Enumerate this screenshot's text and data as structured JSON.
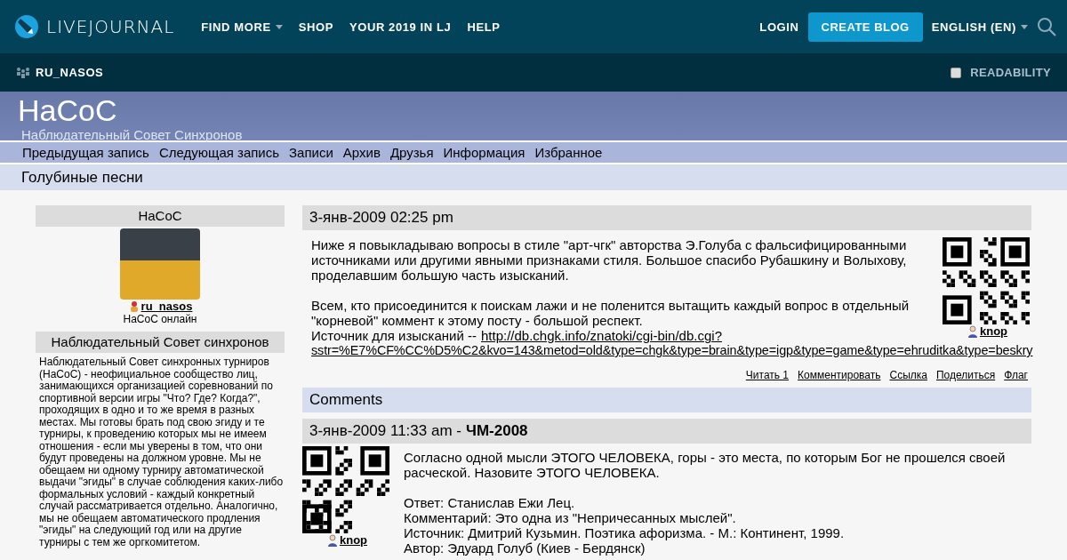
{
  "topbar": {
    "logo": "LIVEJOURNAL",
    "nav": [
      {
        "label": "FIND MORE",
        "dropdown": true
      },
      {
        "label": "SHOP",
        "dropdown": false
      },
      {
        "label": "YOUR 2019 IN LJ",
        "dropdown": false
      },
      {
        "label": "HELP",
        "dropdown": false
      }
    ],
    "login": "LOGIN",
    "create": "CREATE BLOG",
    "language": "ENGLISH (EN)"
  },
  "journalbar": {
    "name": "RU_NASOS",
    "readability": {
      "label": "READABILITY",
      "checked": false
    }
  },
  "blog": {
    "title": "НаСоС",
    "subtitle": "Наблюдательный Совет Синхронов"
  },
  "blognav": [
    "Предыдущая запись",
    "Следующая запись",
    "Записи",
    "Архив",
    "Друзья",
    "Информация",
    "Избранное"
  ],
  "page_title": "Голубиные песни",
  "sidebar": {
    "profile_title": "НаСоС",
    "username": "ru_nasos",
    "status": "НаСоС онлайн",
    "about_title": "Наблюдательный Совет синхронов",
    "about": "Наблюдательный Совет синхронных турниров (НаСоС) - неофициальное сообщество лиц, занимающихся организацией соревнований по спортивной версии игры \"Что? Где? Когда?\", проходящих в одно и то же время в разных местах. Мы готовы брать под свою эгиду и те турниры, к проведению которых мы не имеем отношения - если мы уверены в том, что они будут проведены на должном уровне. Мы не обещаем ни одному турниру автоматической выдачи \"эгиды\" в случае соблюдения каких-либо формальных условий - каждый конкретный случай рассматривается отдельно. Аналогично, мы не обещаем автоматического продления \"эгиды\" на следующий год или на другие турниры с тем же оргкомитетом."
  },
  "entry": {
    "date": "3-янв-2009 02:25 pm",
    "author": "knop",
    "paragraphs": [
      "Ниже я повыкладываю вопросы в стиле \"арт-чгк\" авторства Э.Голуба с фальсифицированными источниками или другими явными признаками стиля. Большое спасибо Рубашкину и Волыхову, проделавшим большую часть изысканий.",
      "Всем, кто присоединится к поискам лажи и не поленится вытащить каждый вопрос в отдельный \"корневой\" коммент к этому посту - большой респект."
    ],
    "source_label": "Источник для изысканий --",
    "source_link_lines": [
      "http://db.chgk.info/znatoki/cgi-bin/db.cgi?",
      "sstr=%E7%CF%CC%D5%C2&kvo=143&metod=old&type=chgk&type=brain&type=igp&type=game&type=ehruditka&type=beskry"
    ],
    "actions": [
      "Читать 1",
      "Комментировать",
      "Ссылка",
      "Поделиться",
      "Флаг"
    ]
  },
  "comments": {
    "title": "Comments",
    "items": [
      {
        "date": "3-янв-2009 11:33 am -",
        "subject": "ЧМ-2008",
        "author": "knop",
        "paragraphs": [
          "Согласно одной мысли ЭТОГО ЧЕЛОВЕКА, горы - это места, по которым Бог не прошелся своей расческой. Назовите ЭТОГО ЧЕЛОВЕКА."
        ],
        "lines": [
          "Ответ: Станислав Ежи Лец.",
          "Комментарий: Это одна из \"Непричесанных мыслей\".",
          "Источник: Дмитрий Кузьмин. Поэтика афоризма. - М.: Континент, 1999.",
          "Автор: Эдуард Голуб (Киев - Бердянск)"
        ]
      }
    ]
  }
}
